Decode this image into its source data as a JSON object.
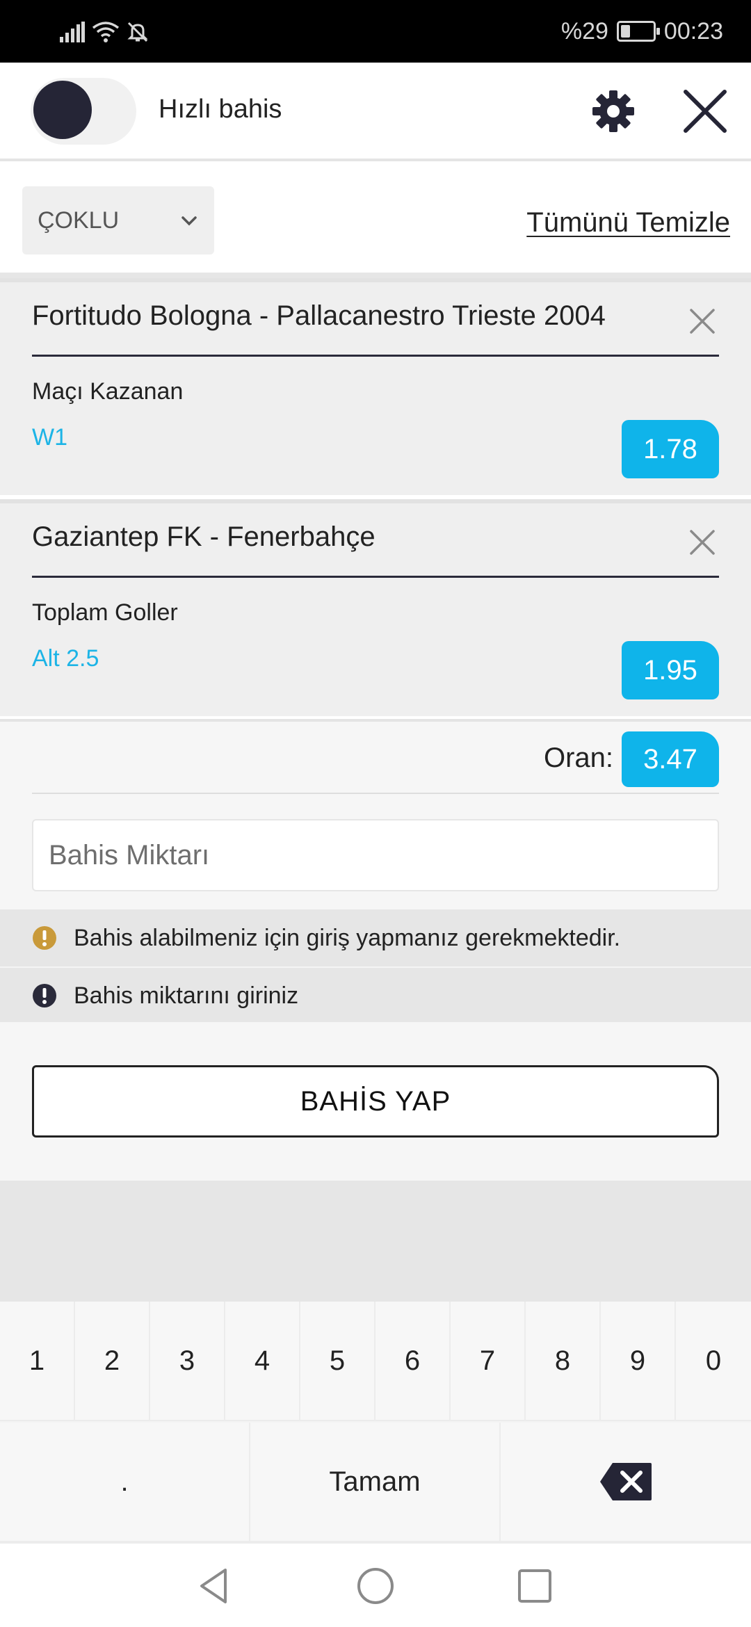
{
  "status_bar": {
    "battery_text": "%29",
    "battery_level": 0.29,
    "time": "00:23",
    "icons": [
      "signal-icon",
      "wifi-icon",
      "bell-off-icon",
      "battery-icon"
    ]
  },
  "header": {
    "quick_bet_label": "Hızlı bahis",
    "quick_bet_enabled": false,
    "settings_icon": "gear-icon",
    "close_icon": "close-icon"
  },
  "bet_mode": {
    "selected": "ÇOKLU",
    "clear_all_label": "Tümünü Temizle"
  },
  "bets": [
    {
      "match": "Fortitudo Bologna - Pallacanestro Trieste 2004",
      "market": "Maçı Kazanan",
      "selection": "W1",
      "odds": "1.78"
    },
    {
      "match": "Gaziantep FK - Fenerbahçe",
      "market": "Toplam Goller",
      "selection": "Alt 2.5",
      "odds": "1.95"
    }
  ],
  "summary": {
    "total_odds_label": "Oran:",
    "total_odds": "3.47",
    "stake_placeholder": "Bahis Miktarı",
    "stake_value": ""
  },
  "notices": [
    {
      "icon": "warning-icon",
      "color": "#c99a3a",
      "text": "Bahis alabilmeniz için giriş yapmanız gerekmektedir."
    },
    {
      "icon": "alert-icon",
      "color": "#2a2a3a",
      "text": "Bahis miktarını giriniz"
    }
  ],
  "place_bet_label": "BAHİS YAP",
  "keyboard": {
    "digits": [
      "1",
      "2",
      "3",
      "4",
      "5",
      "6",
      "7",
      "8",
      "9",
      "0"
    ],
    "decimal": ".",
    "done": "Tamam",
    "backspace_icon": "backspace-icon"
  },
  "colors": {
    "accent": "#0fb4ea",
    "selection_text": "#1cb4e6",
    "toggle_knob": "#252536"
  }
}
